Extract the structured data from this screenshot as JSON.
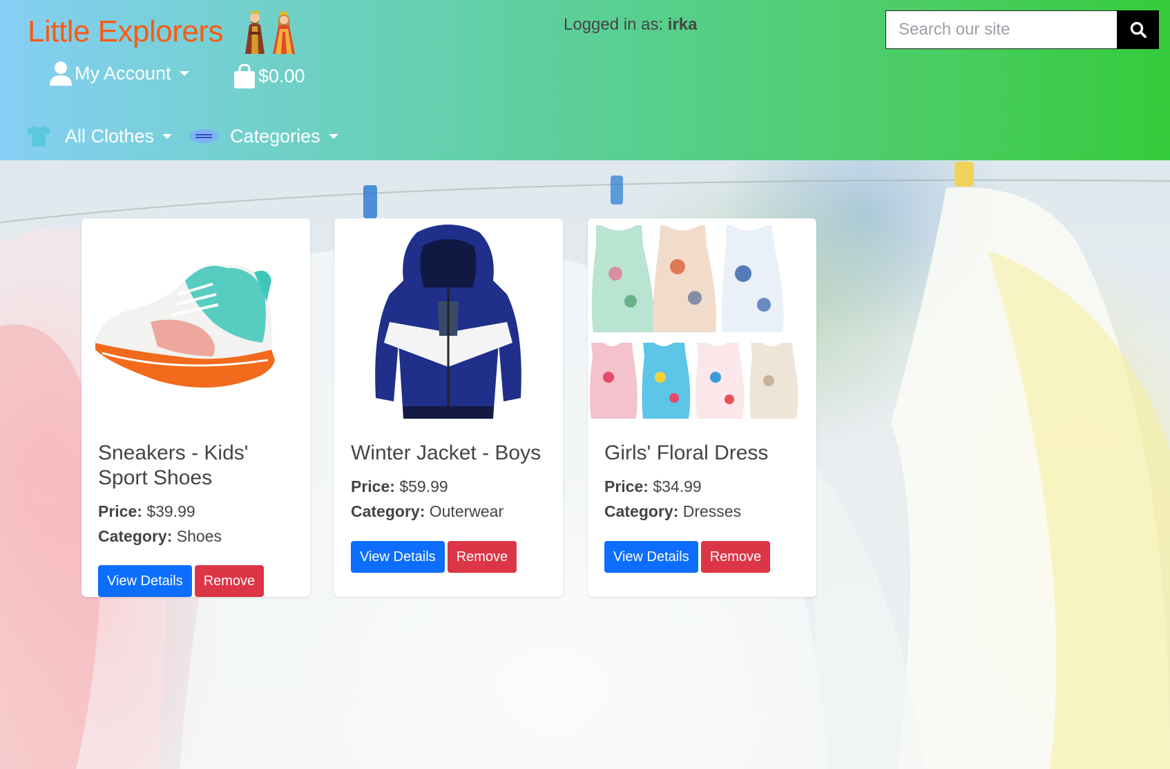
{
  "header": {
    "brand": "Little Explorers",
    "logged_in_prefix": "Logged in as: ",
    "username": "irka",
    "search_placeholder": "Search our site",
    "account_label": "My Account",
    "cart_total": "$0.00",
    "nav": [
      {
        "label": "All Clothes"
      },
      {
        "label": "Categories"
      }
    ]
  },
  "colors": {
    "brand": "#fa5a14",
    "primary": "#0d6efd",
    "danger": "#dc3545"
  },
  "products": [
    {
      "title": "Sneakers - Kids' Sport Shoes",
      "price_label": "Price:",
      "price": "$39.99",
      "category_label": "Category:",
      "category": "Shoes",
      "view_label": "View Details",
      "remove_label": "Remove",
      "image": "sneaker-image"
    },
    {
      "title": "Winter Jacket - Boys",
      "price_label": "Price:",
      "price": "$59.99",
      "category_label": "Category:",
      "category": "Outerwear",
      "view_label": "View Details",
      "remove_label": "Remove",
      "image": "jacket-image"
    },
    {
      "title": "Girls' Floral Dress",
      "price_label": "Price:",
      "price": "$34.99",
      "category_label": "Category:",
      "category": "Dresses",
      "view_label": "View Details",
      "remove_label": "Remove",
      "image": "dresses-image"
    }
  ]
}
